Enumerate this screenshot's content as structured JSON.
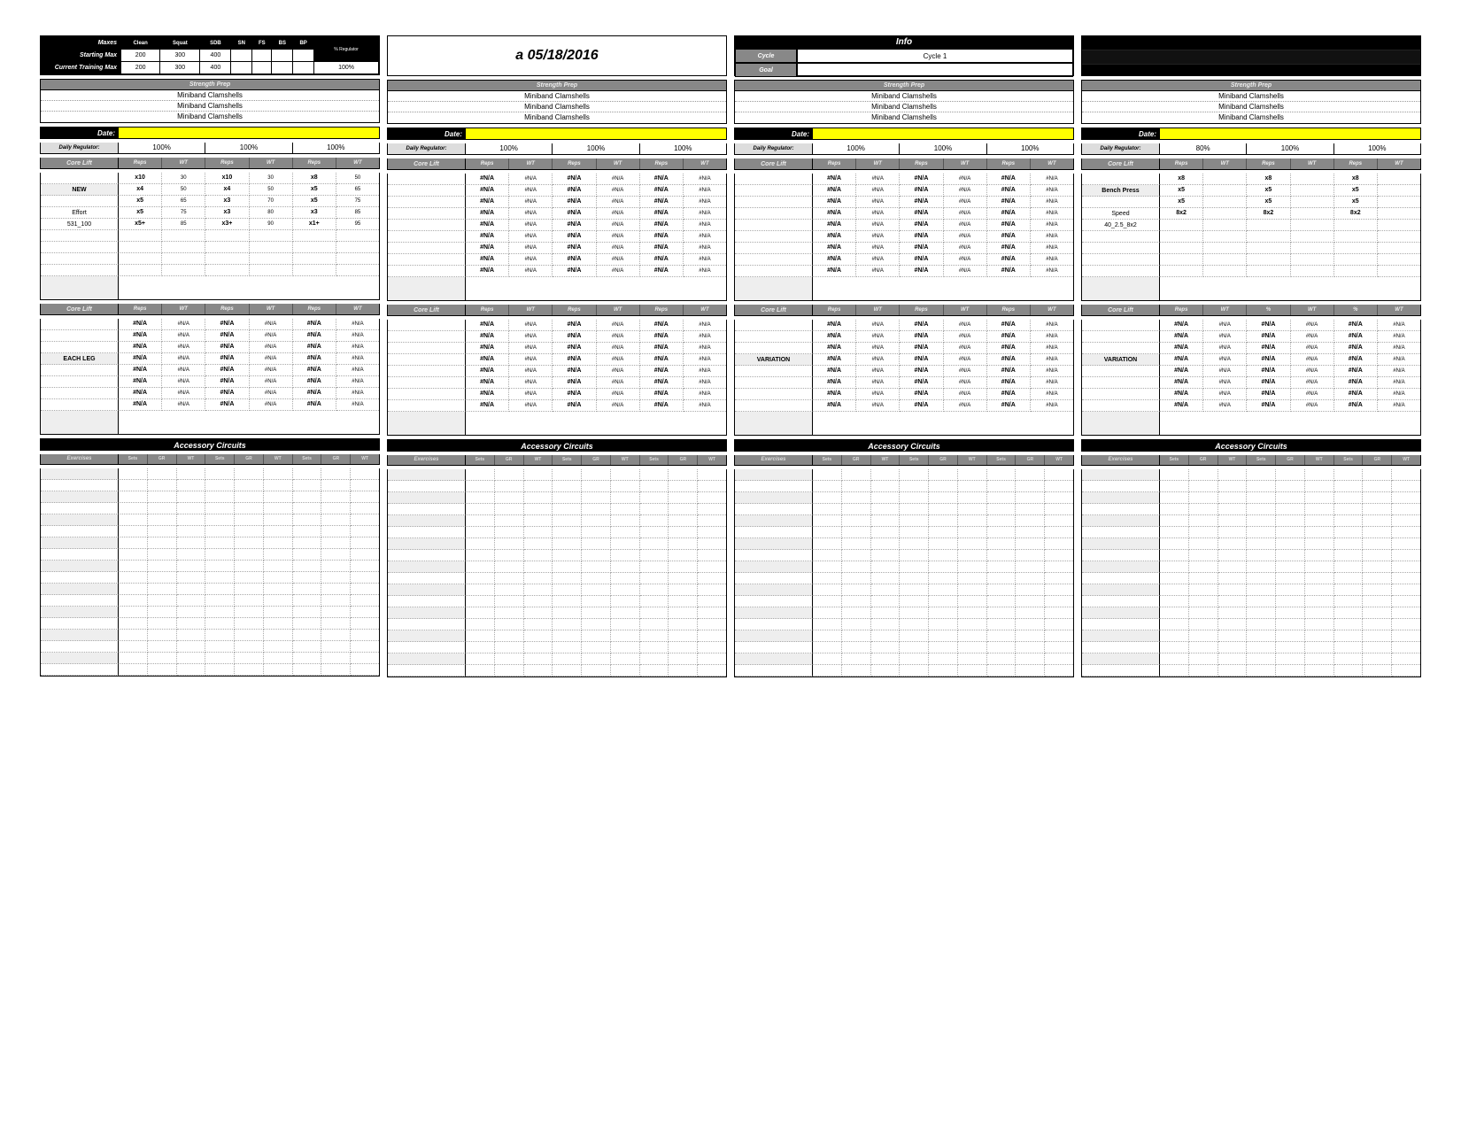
{
  "labels": {
    "maxes": "Maxes",
    "starting_max": "Starting Max",
    "current_max": "Current Training Max",
    "pct_regulator": "% Regulator",
    "strength_prep": "Strength Prep",
    "date": "Date:",
    "daily_regulator": "Daily Regulator:",
    "core_lift": "Core Lift",
    "reps": "Reps",
    "wt": "WT",
    "pct": "%",
    "accessory": "Accessory Circuits",
    "exercises": "Exercises",
    "sets": "Sets",
    "gr": "GR",
    "info": "Info",
    "cycle": "Cycle",
    "goal": "Goal"
  },
  "title": "a 05/18/2016",
  "cycle_value": "Cycle 1",
  "max_headers": [
    "Clean",
    "Squat",
    "SDB",
    "SN",
    "FS",
    "BS",
    "BP"
  ],
  "starting_max": [
    "200",
    "300",
    "400",
    "",
    "",
    "",
    ""
  ],
  "current_max": [
    "200",
    "300",
    "400",
    "",
    "",
    "",
    ""
  ],
  "pct_reg_value": "100%",
  "prep_item": "Miniband Clamshells",
  "na": "#N/A",
  "nas": "#N/A",
  "days": [
    {
      "regulator": [
        "100%",
        "100%",
        "100%"
      ],
      "lift1": {
        "names": [
          "",
          "NEW",
          "",
          "Effort",
          "531_100",
          "",
          "",
          "",
          ""
        ],
        "name_plain": [
          true,
          false,
          true,
          true,
          true,
          true,
          true,
          true,
          true
        ],
        "rows": [
          [
            "x10",
            "30",
            "x10",
            "30",
            "x8",
            "50"
          ],
          [
            "x4",
            "50",
            "x4",
            "50",
            "x5",
            "65"
          ],
          [
            "x5",
            "65",
            "x3",
            "70",
            "x5",
            "75"
          ],
          [
            "x5",
            "75",
            "x3",
            "80",
            "x3",
            "85"
          ],
          [
            "x5+",
            "85",
            "x3+",
            "90",
            "x1+",
            "95"
          ],
          [
            "",
            "",
            "",
            "",
            "",
            ""
          ],
          [
            "",
            "",
            "",
            "",
            "",
            ""
          ],
          [
            "",
            "",
            "",
            "",
            "",
            ""
          ],
          [
            "",
            "",
            "",
            "",
            "",
            ""
          ]
        ]
      },
      "lift2": {
        "names": [
          "",
          "",
          "",
          "EACH LEG",
          "",
          "",
          "",
          ""
        ],
        "rows": "na8"
      }
    },
    {
      "regulator": [
        "100%",
        "100%",
        "100%"
      ],
      "lift1": {
        "rows": "na9"
      },
      "lift2": {
        "rows": "na8"
      }
    },
    {
      "regulator": [
        "100%",
        "100%",
        "100%"
      ],
      "lift1": {
        "rows": "na9"
      },
      "lift2": {
        "names": [
          "",
          "",
          "",
          "VARIATION",
          "",
          "",
          "",
          ""
        ],
        "rows": "na8"
      }
    },
    {
      "regulator": [
        "80%",
        "100%",
        "100%"
      ],
      "lift1": {
        "names": [
          "",
          "Bench Press",
          "",
          "Speed",
          "40_2.5_8x2",
          "",
          "",
          "",
          ""
        ],
        "name_plain": [
          true,
          false,
          true,
          true,
          true,
          true,
          true,
          true,
          true
        ],
        "rows": [
          [
            "x8",
            "",
            "x8",
            "",
            "x8",
            ""
          ],
          [
            "x5",
            "",
            "x5",
            "",
            "x5",
            ""
          ],
          [
            "x5",
            "",
            "x5",
            "",
            "x5",
            ""
          ],
          [
            "8x2",
            "",
            "8x2",
            "",
            "8x2",
            ""
          ],
          [
            "",
            "",
            "",
            "",
            "",
            ""
          ],
          [
            "",
            "",
            "",
            "",
            "",
            ""
          ],
          [
            "",
            "",
            "",
            "",
            "",
            ""
          ],
          [
            "",
            "",
            "",
            "",
            "",
            ""
          ],
          [
            "",
            "",
            "",
            "",
            "",
            ""
          ]
        ]
      },
      "lift2": {
        "names": [
          "",
          "",
          "",
          "VARIATION",
          "",
          "",
          "",
          ""
        ],
        "rows": "na8",
        "hdr_alt": true
      }
    }
  ]
}
